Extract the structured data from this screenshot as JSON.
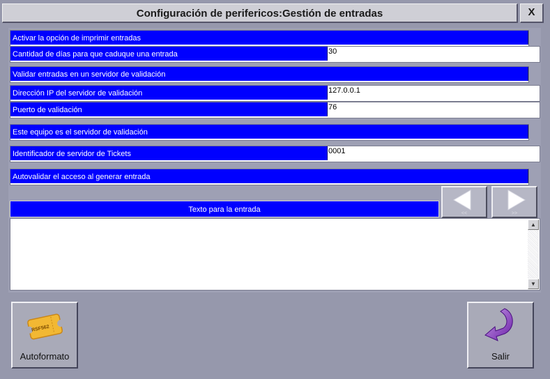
{
  "window": {
    "title": "Configuración de perifericos:Gestión de entradas",
    "close_label": "X"
  },
  "settings": [
    {
      "label": "Activar la opción de imprimir entradas",
      "value": ""
    },
    {
      "label": "Cantidad de días para que caduque una entrada",
      "value": "30"
    },
    {
      "label": "Validar entradas en un servidor de validación",
      "value": ""
    },
    {
      "label": "Dirección IP del servidor de validación",
      "value": "127.0.0.1"
    },
    {
      "label": "Puerto de validación",
      "value": "76"
    },
    {
      "label": "Este equipo es el servidor de validación",
      "value": ""
    },
    {
      "label": "Identificador de servidor de Tickets",
      "value": "0001"
    },
    {
      "label": "Autovalidar el acceso al generar entrada",
      "value": ""
    }
  ],
  "ticket_text": {
    "label": "Texto para la entrada",
    "value": ""
  },
  "nav": {
    "prev_sub": "<<",
    "next_sub": ">>"
  },
  "buttons": {
    "autoformat": "Autoformato",
    "exit": "Salir",
    "ticket_icon_text": "RSF562"
  },
  "colors": {
    "label_bg": "#0000ff",
    "background": "#9698ac"
  }
}
